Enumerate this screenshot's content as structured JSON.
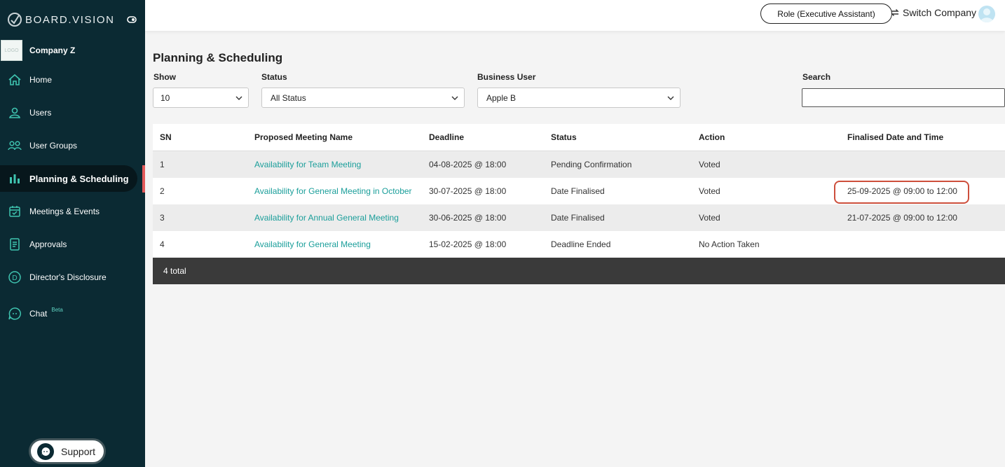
{
  "app": {
    "brand": "BOARD.VISION"
  },
  "company": {
    "name": "Company Z"
  },
  "sidebar": {
    "items": [
      {
        "label": "Home",
        "icon": "home-icon"
      },
      {
        "label": "Users",
        "icon": "user-icon"
      },
      {
        "label": "User Groups",
        "icon": "users-icon"
      },
      {
        "label": "Planning & Scheduling",
        "icon": "bar-chart-icon"
      },
      {
        "label": "Meetings & Events",
        "icon": "calendar-check-icon"
      },
      {
        "label": "Approvals",
        "icon": "document-icon"
      },
      {
        "label": "Director's Disclosure",
        "icon": "circle-d-icon"
      },
      {
        "label": "Chat",
        "icon": "chat-icon",
        "badge": "Beta"
      }
    ],
    "active_index": 3
  },
  "support": {
    "label": "Support"
  },
  "topbar": {
    "role": "Role (Executive Assistant)",
    "switch_company": "Switch Company"
  },
  "page": {
    "title": "Planning & Scheduling"
  },
  "filters": {
    "show_label": "Show",
    "show_value": "10",
    "status_label": "Status",
    "status_value": "All Status",
    "business_user_label": "Business User",
    "business_user_value": "Apple B",
    "search_label": "Search",
    "search_value": ""
  },
  "table": {
    "headers": [
      "SN",
      "Proposed Meeting Name",
      "Deadline",
      "Status",
      "Action",
      "Finalised Date and Time"
    ],
    "rows": [
      {
        "sn": "1",
        "name": "Availability for Team Meeting",
        "deadline": "04-08-2025 @ 18:00",
        "status": "Pending Confirmation",
        "action": "Voted",
        "finalised": ""
      },
      {
        "sn": "2",
        "name": "Availability for General Meeting in October",
        "deadline": "30-07-2025 @ 18:00",
        "status": "Date Finalised",
        "action": "Voted",
        "finalised": "25-09-2025 @ 09:00 to 12:00"
      },
      {
        "sn": "3",
        "name": "Availability for Annual General Meeting",
        "deadline": "30-06-2025 @ 18:00",
        "status": "Date Finalised",
        "action": "Voted",
        "finalised": "21-07-2025 @ 09:00 to 12:00"
      },
      {
        "sn": "4",
        "name": "Availability for General Meeting",
        "deadline": "15-02-2025 @ 18:00",
        "status": "Deadline Ended",
        "action": "No Action Taken",
        "finalised": ""
      }
    ],
    "total": "4 total"
  },
  "colors": {
    "sidebar": "#0b2a33",
    "accent_link": "#1a9e9a",
    "highlight": "#cd4f3c",
    "active_marker": "#e35a5a"
  }
}
